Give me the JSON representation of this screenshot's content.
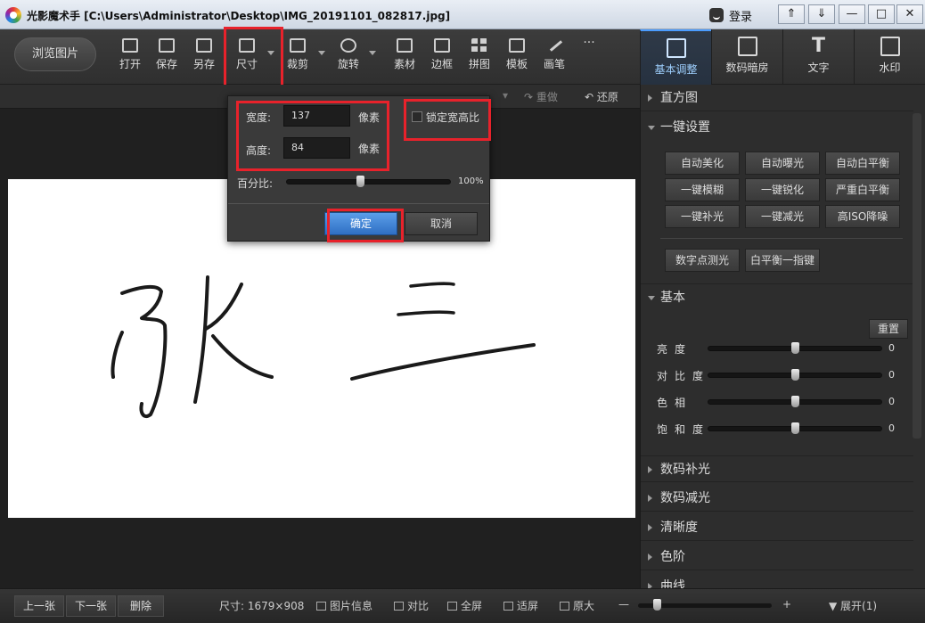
{
  "window": {
    "title": "光影魔术手  [C:\\Users\\Administrator\\Desktop\\IMG_20191101_082817.jpg]",
    "login": "登录",
    "controls": [
      "⇑",
      "⇓",
      "—",
      "□",
      "✕"
    ]
  },
  "toolbar": {
    "browse": "浏览图片",
    "tools": [
      "打开",
      "保存",
      "另存",
      "尺寸",
      "裁剪",
      "旋转",
      "素材",
      "边框",
      "拼图",
      "模板",
      "画笔"
    ],
    "more": "···",
    "right_tabs": [
      "基本调整",
      "数码暗房",
      "文字",
      "水印"
    ]
  },
  "canvas": {
    "redo": "重做",
    "restore": "还原"
  },
  "resize_popup": {
    "width_label": "宽度:",
    "width_value": "137",
    "width_unit": "像素",
    "height_label": "高度:",
    "height_value": "84",
    "height_unit": "像素",
    "lock_ratio": "锁定宽高比",
    "lock_ratio_checked": false,
    "percent_label": "百分比:",
    "percent_value": "100%",
    "percent_slider": 0.45,
    "ok": "确定",
    "cancel": "取消"
  },
  "panel": {
    "histogram": "直方图",
    "oneclick": "一键设置",
    "oneclick_buttons": [
      [
        "自动美化",
        "自动曝光",
        "自动白平衡"
      ],
      [
        "一键模糊",
        "一键锐化",
        "严重白平衡"
      ],
      [
        "一键补光",
        "一键减光",
        "高ISO降噪"
      ]
    ],
    "extra_buttons": [
      "数字点测光",
      "白平衡一指键"
    ],
    "basic": "基本",
    "reset": "重置",
    "adjustments": [
      {
        "label": "亮度",
        "value": "0",
        "level": 0.5
      },
      {
        "label": "对比度",
        "value": "0",
        "level": 0.5
      },
      {
        "label": "色相",
        "value": "0",
        "level": 0.5
      },
      {
        "label": "饱和度",
        "value": "0",
        "level": 0.5
      }
    ],
    "sections": [
      "数码补光",
      "数码减光",
      "清晰度",
      "色阶",
      "曲线"
    ]
  },
  "statusbar": {
    "prev": "上一张",
    "next": "下一张",
    "delete": "删除",
    "size": "尺寸: 1679×908",
    "info": "图片信息",
    "compare": "对比",
    "fullscreen": "全屏",
    "fit": "适屏",
    "original": "原大",
    "zoom_minus": "—",
    "zoom_plus": "+",
    "expand": "展开(1)"
  },
  "colors": {
    "highlight": "#e8222b",
    "accent": "#4a9cff"
  }
}
